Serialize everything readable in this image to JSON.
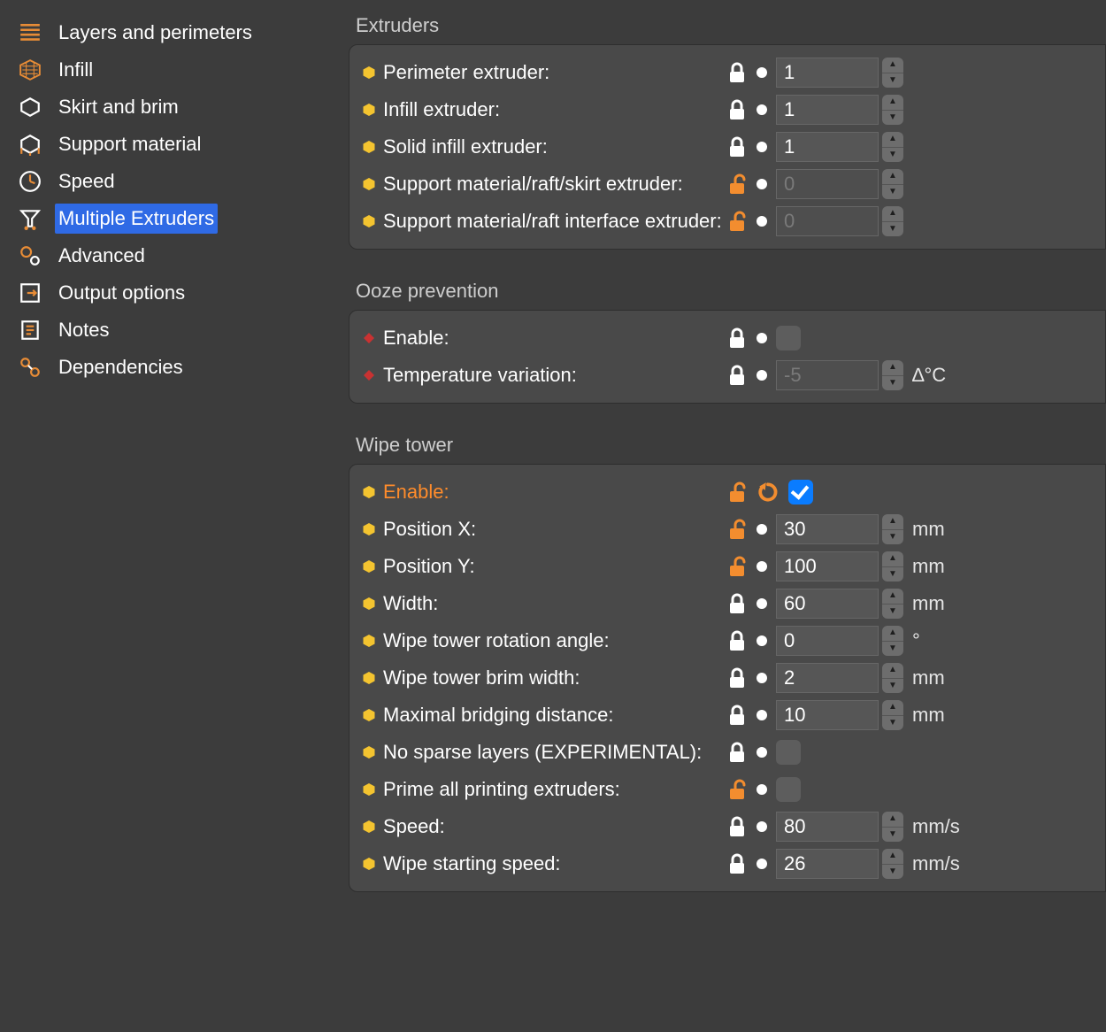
{
  "sidebar": {
    "items": [
      {
        "label": "Layers and perimeters",
        "id": "layers"
      },
      {
        "label": "Infill",
        "id": "infill"
      },
      {
        "label": "Skirt and brim",
        "id": "skirt"
      },
      {
        "label": "Support material",
        "id": "support"
      },
      {
        "label": "Speed",
        "id": "speed"
      },
      {
        "label": "Multiple Extruders",
        "id": "multi"
      },
      {
        "label": "Advanced",
        "id": "advanced"
      },
      {
        "label": "Output options",
        "id": "output"
      },
      {
        "label": "Notes",
        "id": "notes"
      },
      {
        "label": "Dependencies",
        "id": "deps"
      }
    ],
    "selected": "multi"
  },
  "sections": {
    "extruders": {
      "title": "Extruders",
      "rows": [
        {
          "label": "Perimeter extruder:",
          "value": "1",
          "unit": "",
          "lock": "white",
          "disabled": false,
          "spinner": true,
          "bullet": "hex"
        },
        {
          "label": "Infill extruder:",
          "value": "1",
          "unit": "",
          "lock": "white",
          "disabled": false,
          "spinner": true,
          "bullet": "hex"
        },
        {
          "label": "Solid infill extruder:",
          "value": "1",
          "unit": "",
          "lock": "white",
          "disabled": false,
          "spinner": true,
          "bullet": "hex"
        },
        {
          "label": "Support material/raft/skirt extruder:",
          "value": "0",
          "unit": "",
          "lock": "orange",
          "disabled": true,
          "spinner": true,
          "bullet": "hex"
        },
        {
          "label": "Support material/raft interface extruder:",
          "value": "0",
          "unit": "",
          "lock": "orange",
          "disabled": true,
          "spinner": true,
          "bullet": "hex",
          "two": true
        }
      ]
    },
    "ooze": {
      "title": "Ooze prevention",
      "rows": [
        {
          "label": "Enable:",
          "type": "check",
          "checked": false,
          "lock": "white",
          "bullet": "diamond"
        },
        {
          "label": "Temperature variation:",
          "value": "-5",
          "unit": "∆°C",
          "lock": "white",
          "disabled": true,
          "spinner": true,
          "bullet": "diamond"
        }
      ]
    },
    "wipe": {
      "title": "Wipe tower",
      "rows": [
        {
          "label": "Enable:",
          "type": "check",
          "checked": true,
          "lock": "orange",
          "reset": true,
          "bullet": "hex",
          "orange": true
        },
        {
          "label": "Position X:",
          "value": "30",
          "unit": "mm",
          "lock": "orange",
          "bullet": "hex"
        },
        {
          "label": "Position Y:",
          "value": "100",
          "unit": "mm",
          "lock": "orange",
          "bullet": "hex"
        },
        {
          "label": "Width:",
          "value": "60",
          "unit": "mm",
          "lock": "white",
          "bullet": "hex"
        },
        {
          "label": "Wipe tower rotation angle:",
          "value": "0",
          "unit": "°",
          "lock": "white",
          "bullet": "hex"
        },
        {
          "label": "Wipe tower brim width:",
          "value": "2",
          "unit": "mm",
          "lock": "white",
          "bullet": "hex"
        },
        {
          "label": "Maximal bridging distance:",
          "value": "10",
          "unit": "mm",
          "lock": "white",
          "bullet": "hex"
        },
        {
          "label": "No sparse layers (EXPERIMENTAL):",
          "type": "check",
          "checked": false,
          "lock": "white",
          "bullet": "hex"
        },
        {
          "label": "Prime all printing extruders:",
          "type": "check",
          "checked": false,
          "lock": "orange",
          "bullet": "hex"
        },
        {
          "label": "Speed:",
          "value": "80",
          "unit": "mm/s",
          "lock": "white",
          "bullet": "hex"
        },
        {
          "label": "Wipe starting speed:",
          "value": "26",
          "unit": "mm/s",
          "lock": "white",
          "bullet": "hex"
        }
      ]
    }
  }
}
